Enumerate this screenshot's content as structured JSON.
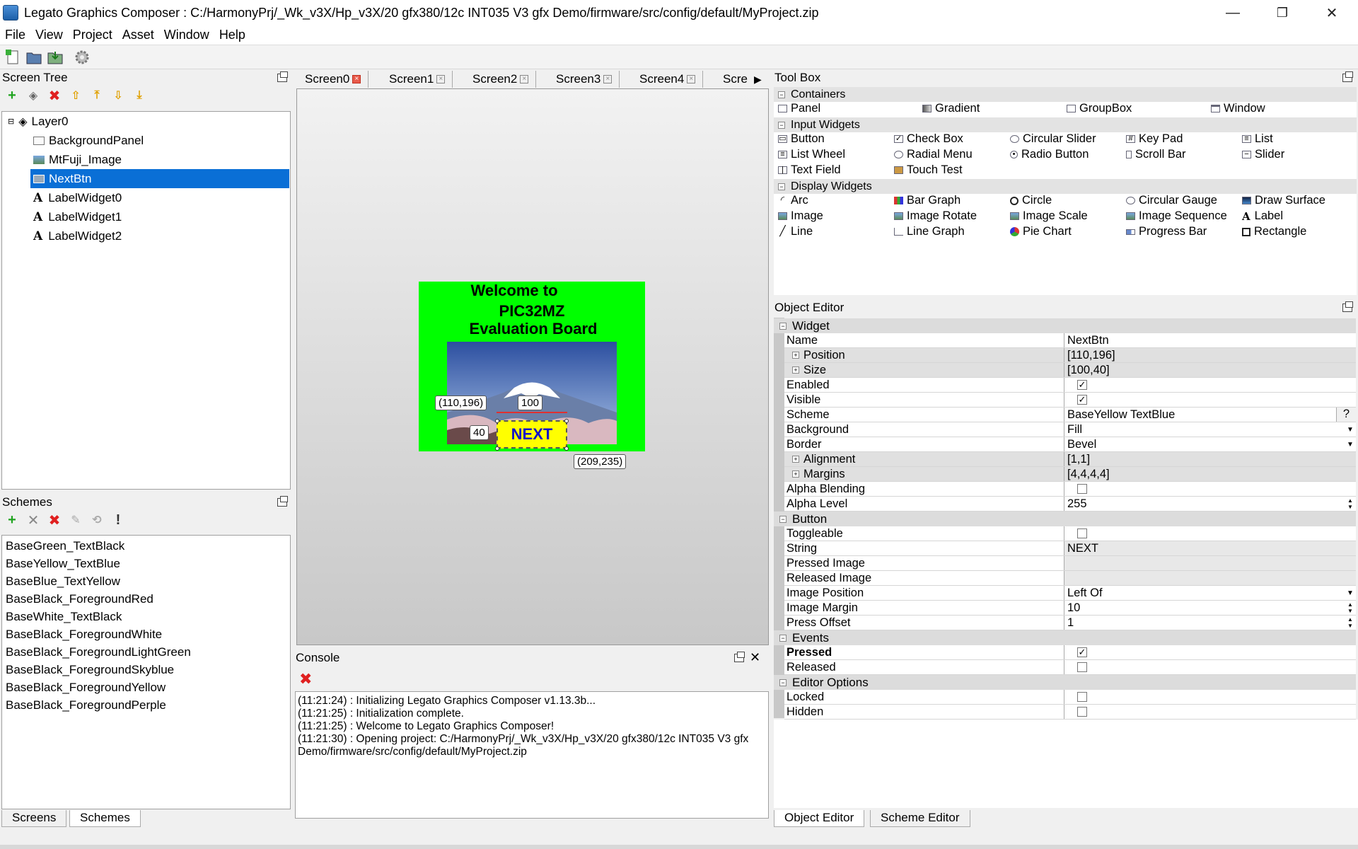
{
  "window": {
    "title": "Legato Graphics Composer : C:/HarmonyPrj/_Wk_v3X/Hp_v3X/20 gfx380/12c INT035 V3 gfx Demo/firmware/src/config/default/MyProject.zip",
    "minimize": "—",
    "restore": "❐",
    "close": "✕"
  },
  "menu": [
    "File",
    "View",
    "Project",
    "Asset",
    "Window",
    "Help"
  ],
  "screen_tree": {
    "title": "Screen Tree",
    "layer": "Layer0",
    "items": [
      "BackgroundPanel",
      "MtFuji_Image",
      "NextBtn",
      "LabelWidget0",
      "LabelWidget1",
      "LabelWidget2"
    ],
    "selected": "NextBtn"
  },
  "schemes": {
    "title": "Schemes",
    "items": [
      "BaseGreen_TextBlack",
      "BaseYellow_TextBlue",
      "BaseBlue_TextYellow",
      "BaseBlack_ForegroundRed",
      "BaseWhite_TextBlack",
      "BaseBlack_ForegroundWhite",
      "BaseBlack_ForegroundLightGreen",
      "BaseBlack_ForegroundSkyblue",
      "BaseBlack_ForegroundYellow",
      "BaseBlack_ForegroundPerple"
    ]
  },
  "left_tabs": [
    "Screens",
    "Schemes"
  ],
  "screen_tabs": [
    "Screen0",
    "Screen1",
    "Screen2",
    "Screen3",
    "Screen4",
    "Scre"
  ],
  "canvas": {
    "label_welcome": "Welcome to",
    "label_pic": "PIC32MZ",
    "label_eval": "Evaluation Board",
    "button_text": "NEXT",
    "pos_tag": "(110,196)",
    "width_tag": "100",
    "height_tag": "40",
    "end_tag": "(209,235)",
    "bg_color": "#00ff00",
    "button_color": "#ffff00",
    "button_text_color": "#1010c8"
  },
  "console": {
    "title": "Console",
    "lines": [
      "(11:21:24) : Initializing Legato Graphics Composer v1.13.3b...",
      "(11:21:25) : Initialization complete.",
      "(11:21:25) : Welcome to Legato Graphics Composer!",
      "(11:21:30) : Opening project: C:/HarmonyPrj/_Wk_v3X/Hp_v3X/20 gfx380/12c INT035 V3 gfx Demo/firmware/src/config/default/MyProject.zip"
    ]
  },
  "toolbox": {
    "title": "Tool Box",
    "sections": {
      "containers": "Containers",
      "input": "Input Widgets",
      "display": "Display Widgets"
    },
    "containers": [
      "Panel",
      "Gradient",
      "GroupBox",
      "Window"
    ],
    "input": [
      "Button",
      "Check Box",
      "Circular Slider",
      "Key Pad",
      "List",
      "List Wheel",
      "Radial Menu",
      "Radio Button",
      "Scroll Bar",
      "Slider",
      "Text Field",
      "Touch Test"
    ],
    "display": [
      "Arc",
      "Bar Graph",
      "Circle",
      "Circular Gauge",
      "Draw Surface",
      "Image",
      "Image Rotate",
      "Image Scale",
      "Image Sequence",
      "Label",
      "Line",
      "Line Graph",
      "Pie Chart",
      "Progress Bar",
      "Rectangle"
    ]
  },
  "object_editor": {
    "title": "Object Editor",
    "sections": {
      "widget": "Widget",
      "button": "Button",
      "events": "Events",
      "editor": "Editor Options"
    },
    "widget": {
      "name_k": "Name",
      "name_v": "NextBtn",
      "position_k": "Position",
      "position_v": "[110,196]",
      "size_k": "Size",
      "size_v": "[100,40]",
      "enabled_k": "Enabled",
      "visible_k": "Visible",
      "scheme_k": "Scheme",
      "scheme_v": "BaseYellow TextBlue",
      "scheme_btn": "?",
      "background_k": "Background",
      "background_v": "Fill",
      "border_k": "Border",
      "border_v": "Bevel",
      "alignment_k": "Alignment",
      "alignment_v": "[1,1]",
      "margins_k": "Margins",
      "margins_v": "[4,4,4,4]",
      "alpha_blend_k": "Alpha Blending",
      "alpha_level_k": "Alpha Level",
      "alpha_level_v": "255"
    },
    "button": {
      "toggleable_k": "Toggleable",
      "string_k": "String",
      "string_v": "NEXT",
      "pressed_img_k": "Pressed Image",
      "released_img_k": "Released Image",
      "img_pos_k": "Image Position",
      "img_pos_v": "Left Of",
      "img_margin_k": "Image Margin",
      "img_margin_v": "10",
      "press_offset_k": "Press Offset",
      "press_offset_v": "1"
    },
    "events": {
      "pressed_k": "Pressed",
      "released_k": "Released"
    },
    "editor": {
      "locked_k": "Locked",
      "hidden_k": "Hidden"
    }
  },
  "right_tabs": [
    "Object Editor",
    "Scheme Editor"
  ]
}
